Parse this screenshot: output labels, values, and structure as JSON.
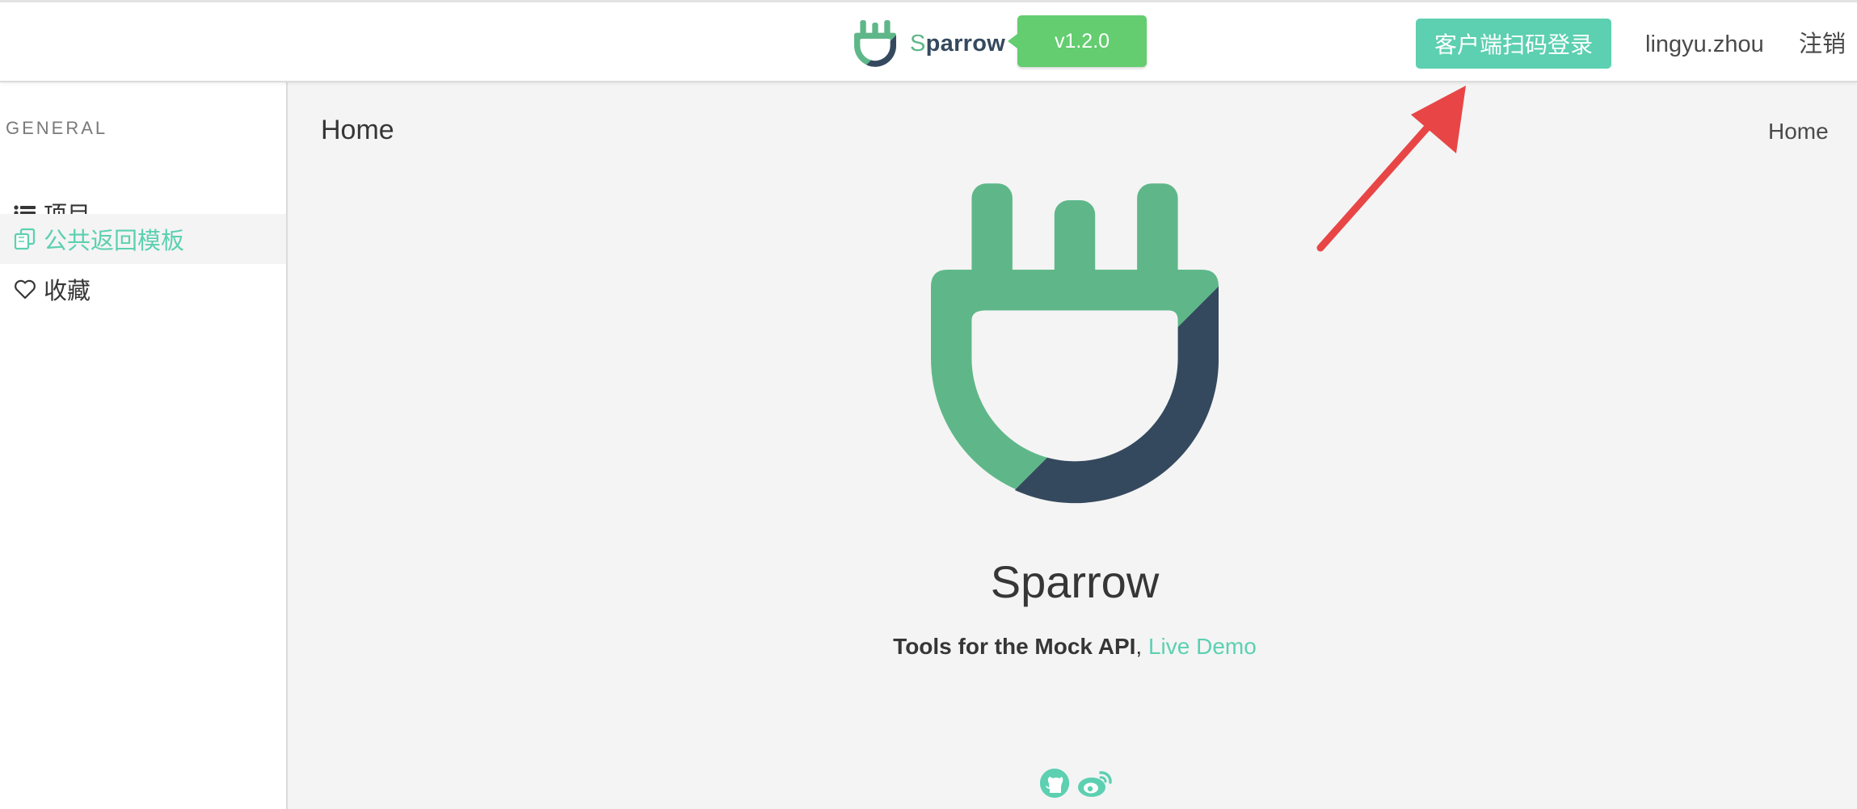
{
  "navbar": {
    "brand_first_letter": "S",
    "brand_rest": "parrow",
    "version": "v1.2.0",
    "scan_login_label": "客户端扫码登录",
    "username": "lingyu.zhou",
    "logout_label": "注销"
  },
  "sidebar": {
    "section_label": "GENERAL",
    "items": [
      {
        "label": "项目",
        "icon": "list-icon",
        "active": false
      },
      {
        "label": "公共返回模板",
        "icon": "copy-icon",
        "active": true
      },
      {
        "label": "收藏",
        "icon": "heart-icon",
        "active": false
      }
    ]
  },
  "main": {
    "page_title": "Home",
    "breadcrumb": "Home",
    "hero": {
      "title": "Sparrow",
      "subtitle_strong": "Tools for the Mock API",
      "subtitle_separator": ", ",
      "demo_link": "Live Demo"
    },
    "social_icons": [
      "github-icon",
      "weibo-icon"
    ]
  },
  "colors": {
    "brand_green": "#5fb789",
    "brand_dark": "#35495e",
    "accent_teal": "#5cd0b1",
    "version_green": "#63cd6f",
    "annotation_red": "#e84646"
  }
}
